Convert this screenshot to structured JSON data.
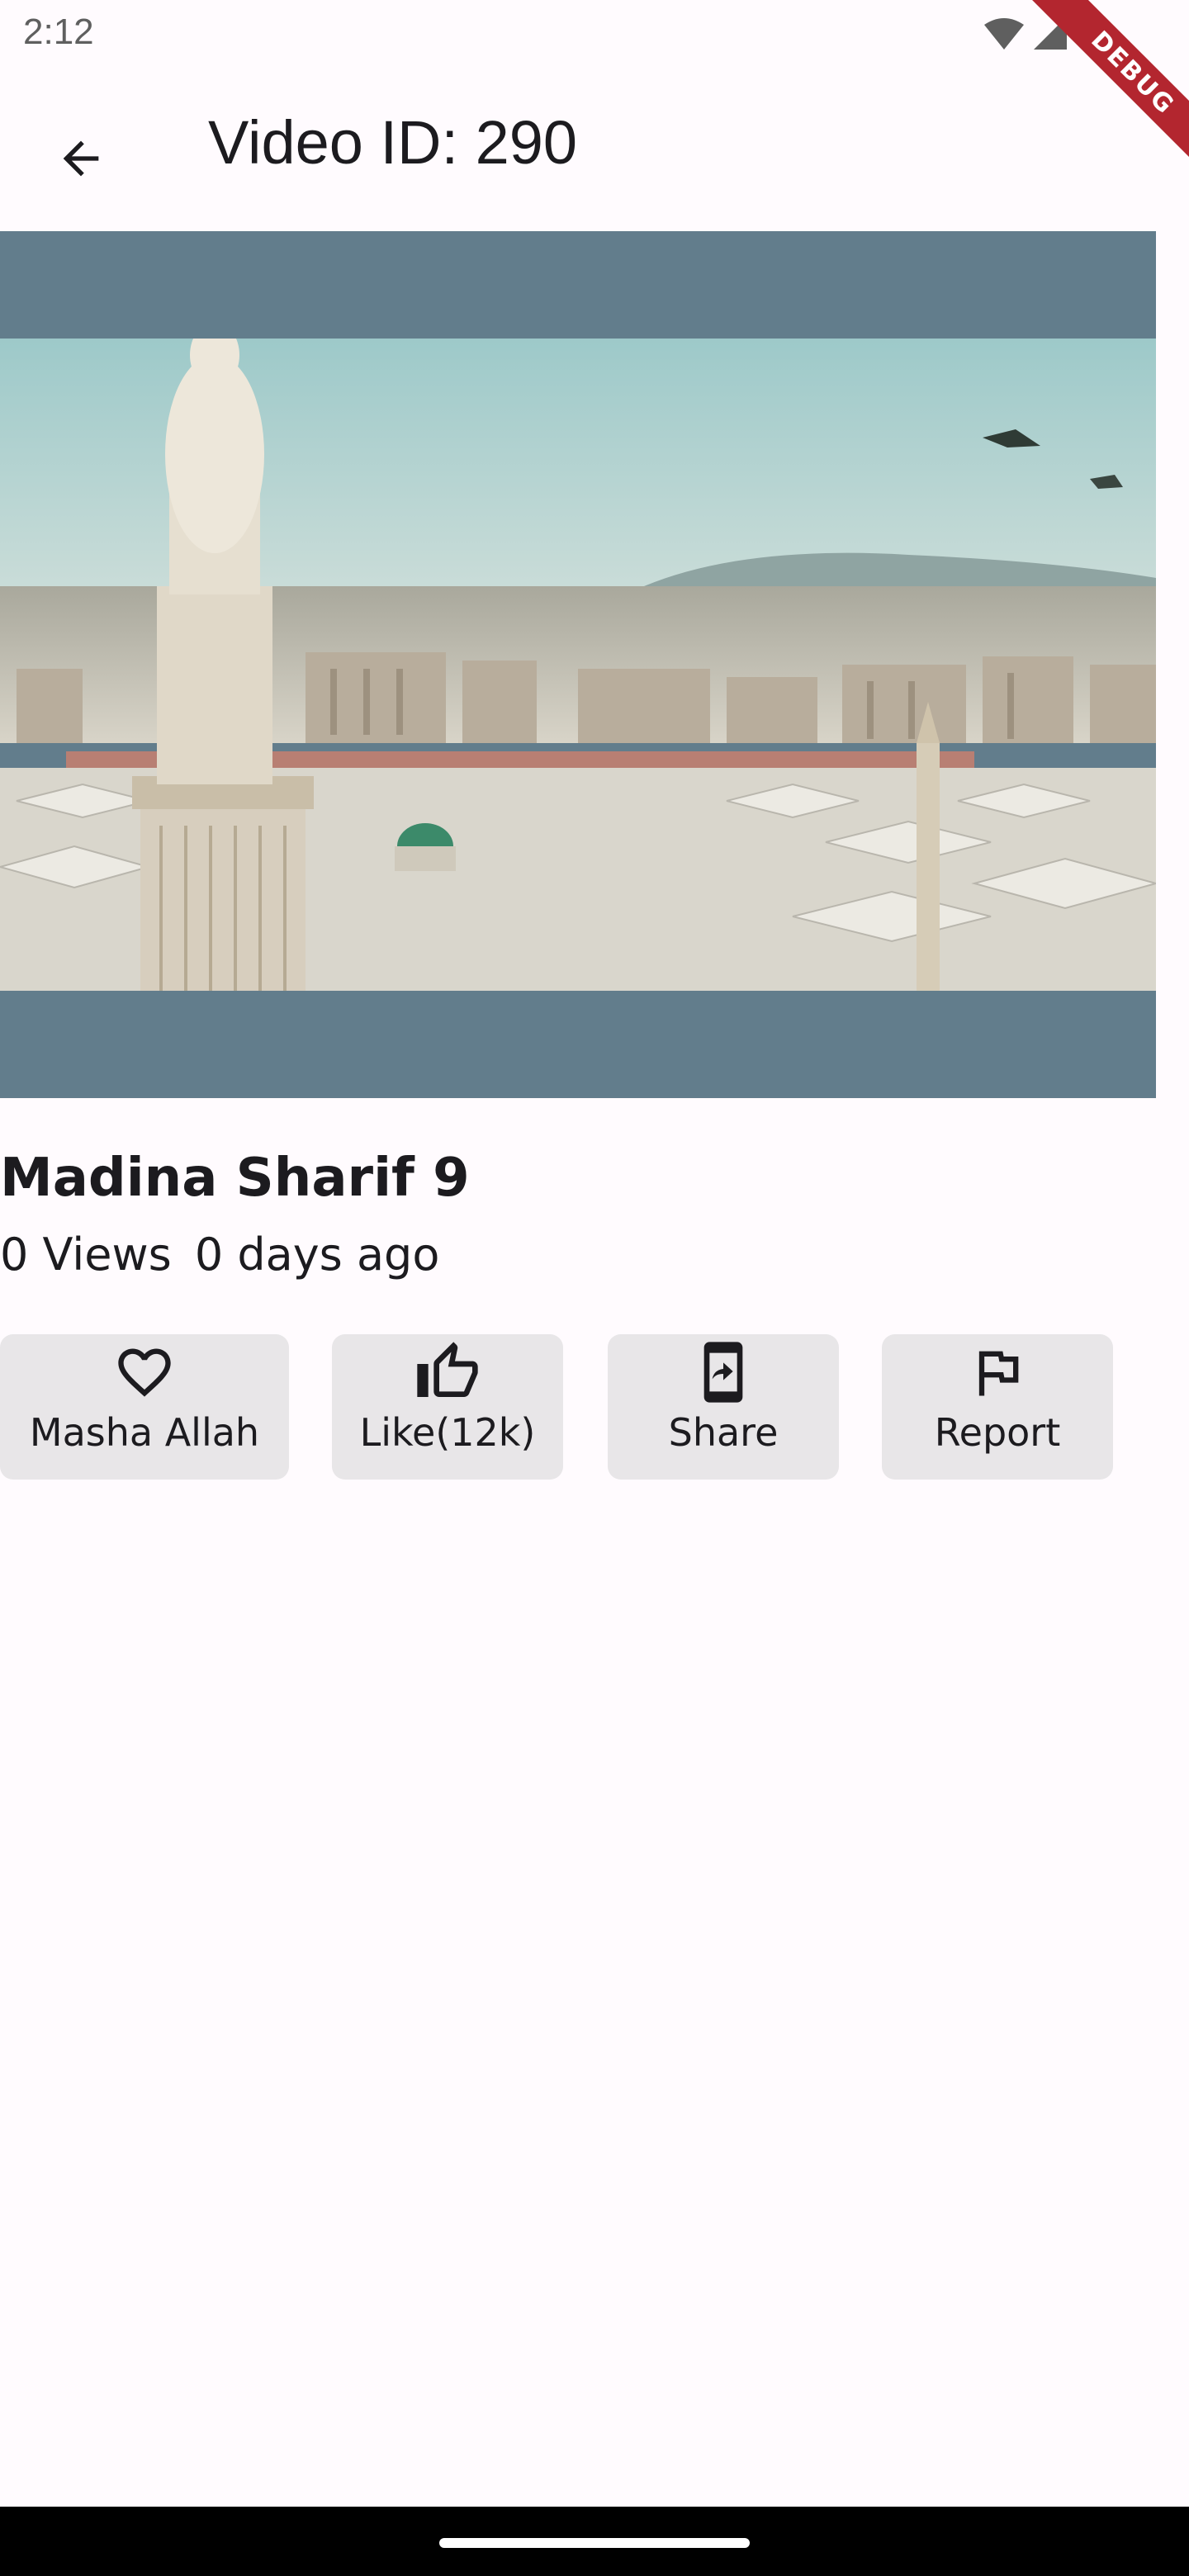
{
  "status_bar": {
    "time": "2:12",
    "debug_label": "DEBUG"
  },
  "app_bar": {
    "title": "Video ID: 290"
  },
  "video": {
    "title": "Madina Sharif 9",
    "views": "0 Views",
    "posted": "0 days ago"
  },
  "actions": [
    {
      "label": "Masha Allah",
      "icon": "heart-icon"
    },
    {
      "label": "Like(12k)",
      "icon": "thumb-up-icon"
    },
    {
      "label": "Share",
      "icon": "share-phone-icon"
    },
    {
      "label": "Report",
      "icon": "flag-icon"
    }
  ],
  "colors": {
    "background": "#fffbfe",
    "player_background": "#627d8c",
    "button_background": "#e8e6e8",
    "debug_ribbon": "#b3262f"
  }
}
